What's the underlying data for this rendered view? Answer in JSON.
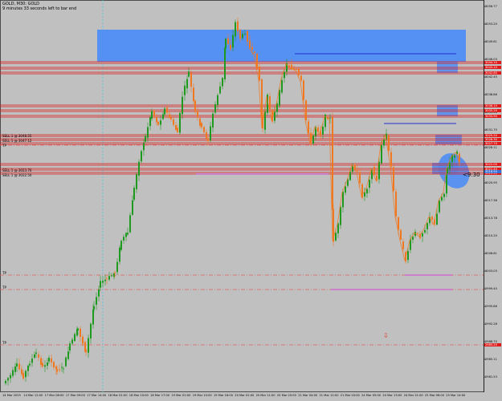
{
  "header": {
    "title": "GOLD, M30: GOLD",
    "subtitle": "9 minutes 33 seconds left to bar end"
  },
  "left_level_labels": [
    {
      "text": "SELL 1 @ 3048.55"
    },
    {
      "text": "SELL 1 @ 3047.12"
    },
    {
      "text": "TP"
    },
    {
      "text": "SELL 1 @ 3023.70"
    },
    {
      "text": "SELL 1 @ 3022.50"
    }
  ],
  "hline_labels": {
    "tp1": "TP",
    "tp2": "TP",
    "tp3": "TP"
  },
  "countdown": "<9:30",
  "price_axis": {
    "ticks": [
      "3056.77",
      "3053.20",
      "3049.61",
      "3046.03",
      "3042.45",
      "3038.86",
      "3035.28",
      "3031.70",
      "3028.11",
      "3024.53",
      "3020.95",
      "3017.36",
      "3013.78",
      "3010.20",
      "3006.61",
      "3003.03",
      "2999.45",
      "2995.86",
      "2992.28",
      "2988.70",
      "2985.11",
      "2981.53"
    ],
    "tags": [
      {
        "text": "3044.10",
        "color": "#e01818"
      },
      {
        "text": "3043.10",
        "color": "#e01818"
      },
      {
        "text": "3042.60",
        "color": "#e01818"
      },
      {
        "text": "3036.10",
        "color": "#e01818"
      },
      {
        "text": "3035.20",
        "color": "#e01818"
      },
      {
        "text": "3033.90",
        "color": "#e01818"
      },
      {
        "text": "3029.20",
        "color": "#e01818"
      },
      {
        "text": "3028.30",
        "color": "#e01818"
      },
      {
        "text": "3027.70",
        "color": "#e01818"
      },
      {
        "text": "3022.00",
        "color": "#e01818"
      },
      {
        "text": "3021.40",
        "color": "#e01818"
      },
      {
        "text": "3020.40",
        "color": "#e01818"
      },
      {
        "text": "3018.94",
        "color": "#3a6fd8"
      },
      {
        "text": "2985.20",
        "color": "#e01818"
      }
    ]
  },
  "time_axis": [
    "14 Mar 2025",
    "14 Mar 12:00",
    "17 Mar 06:00",
    "17 Mar 09:00",
    "17 Mar 14:00",
    "18 Mar 01:00",
    "18 Mar 10:00",
    "18 Mar 17:00",
    "19 Mar 02:00",
    "19 Mar 10:00",
    "19 Mar 18:00",
    "20 Mar 02:00",
    "20 Mar 11:00",
    "20 Mar 20:00",
    "21 Mar 04:00",
    "21 Mar 12:00",
    "21 Mar 20:00",
    "24 Mar 05:00",
    "24 Mar 13:00",
    "24 Mar 21:00",
    "25 Mar 06:00",
    "25 Mar 14:00"
  ],
  "colors": {
    "background": "#c0c0c0",
    "bull_candle": "#1e9a1e",
    "bear_candle": "#f07820",
    "zone_blue": "#4f8df5",
    "level_red": "#e01818",
    "level_magenta": "#d840d8",
    "level_blue": "#2330d0",
    "tp_dashdot": "#e06060"
  },
  "icons": {
    "down_arrow": "down-arrow-icon"
  }
}
